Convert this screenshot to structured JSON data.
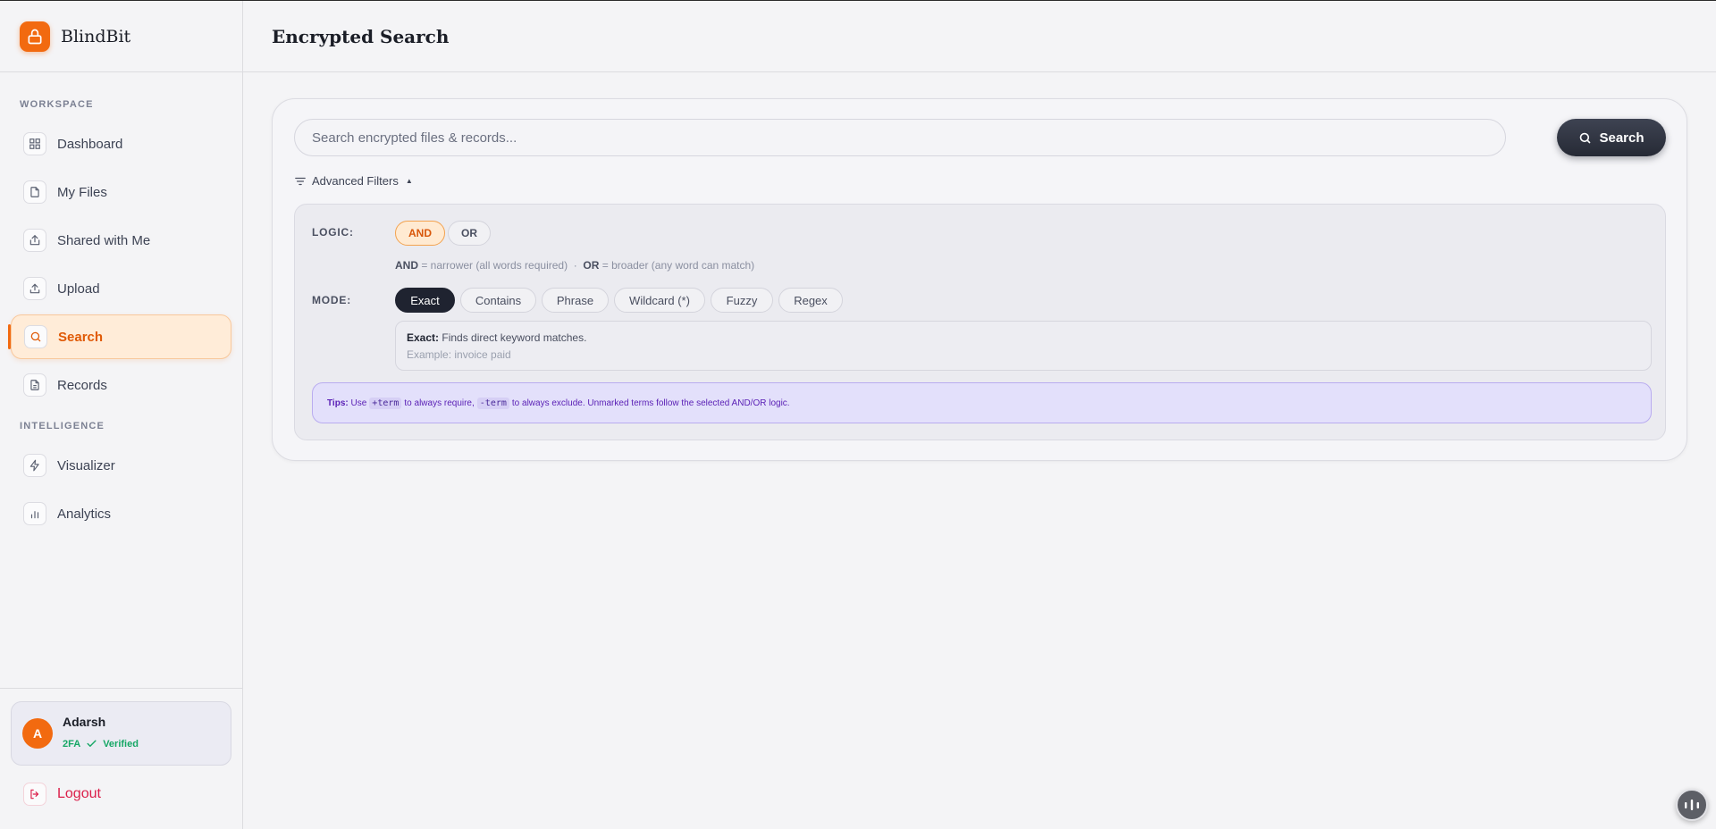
{
  "app": {
    "name": "BlindBit",
    "accent": "#f26a10"
  },
  "sidebar": {
    "sections": {
      "workspace": "WORKSPACE",
      "intelligence": "INTELLIGENCE"
    },
    "items": [
      {
        "label": "Dashboard",
        "icon": "grid-icon"
      },
      {
        "label": "My Files",
        "icon": "file-icon"
      },
      {
        "label": "Shared with Me",
        "icon": "share-icon"
      },
      {
        "label": "Upload",
        "icon": "upload-icon"
      },
      {
        "label": "Search",
        "icon": "search-icon",
        "active": true
      },
      {
        "label": "Records",
        "icon": "document-icon"
      },
      {
        "label": "Visualizer",
        "icon": "bolt-icon"
      },
      {
        "label": "Analytics",
        "icon": "bar-chart-icon"
      }
    ],
    "user": {
      "initial": "A",
      "name": "Adarsh",
      "badge_2fa": "2FA",
      "verified": "Verified"
    },
    "logout": "Logout"
  },
  "header": {
    "title": "Encrypted Search"
  },
  "search": {
    "placeholder": "Search encrypted files & records...",
    "value": "",
    "button_label": "Search"
  },
  "filters": {
    "toggle_label": "Advanced Filters",
    "toggle_arrow": "▲",
    "logic_label": "LOGIC:",
    "logic_options": [
      "AND",
      "OR"
    ],
    "logic_selected": "AND",
    "logic_hint": {
      "and_term": "AND",
      "and_text": "= narrower (all words required)",
      "separator": "·",
      "or_term": "OR",
      "or_text": "= broader (any word can match)"
    },
    "mode_label": "MODE:",
    "mode_options": [
      "Exact",
      "Contains",
      "Phrase",
      "Wildcard (*)",
      "Fuzzy",
      "Regex"
    ],
    "mode_selected": "Exact",
    "mode_description": {
      "name": "Exact:",
      "text": "Finds direct keyword matches.",
      "example": "Example: invoice paid"
    },
    "tips": {
      "label": "Tips:",
      "part1": "Use",
      "code1": "+term",
      "part2": "to always require,",
      "code2": "-term",
      "part3": "to always exclude. Unmarked terms follow the selected AND/OR logic."
    }
  }
}
